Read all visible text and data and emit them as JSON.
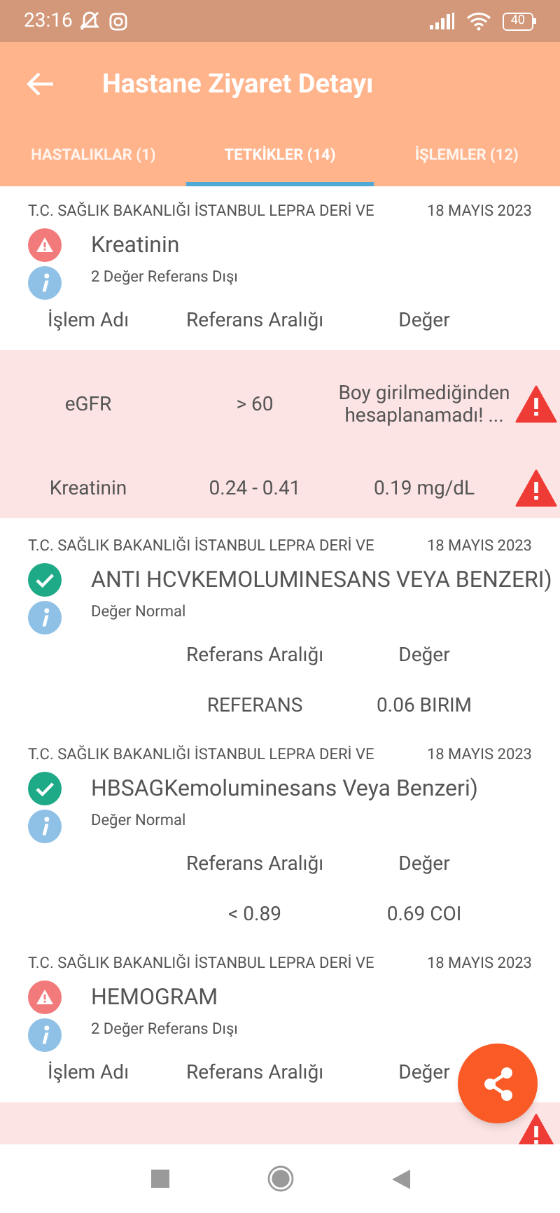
{
  "status_bar": {
    "time": "23:16",
    "battery": "40"
  },
  "app_bar": {
    "title": "Hastane Ziyaret Detayı"
  },
  "tabs": [
    {
      "label": "HASTALIKLAR (1)",
      "selected": false
    },
    {
      "label": "TETKİKLER (14)",
      "selected": true
    },
    {
      "label": "İŞLEMLER (12)",
      "selected": false
    }
  ],
  "results": [
    {
      "institution": "T.C. SAĞLIK BAKANLIĞI İSTANBUL LEPRA DERİ VE",
      "date": "18 MAYIS 2023",
      "kind": "abnormal",
      "title": "Kreatinin",
      "summary": "2 Değer Referans Dışı",
      "columns": [
        "İşlem Adı",
        "Referans Aralığı",
        "Değer"
      ],
      "rows": [
        {
          "name": "eGFR",
          "reference": "> 60",
          "value": "Boy girilmediğinden hesaplanamadı! ...",
          "out_of_range": true
        },
        {
          "name": "Kreatinin",
          "reference": "0.24 - 0.41",
          "value": "0.19 mg/dL",
          "out_of_range": true
        }
      ]
    },
    {
      "institution": "T.C. SAĞLIK BAKANLIĞI İSTANBUL LEPRA DERİ VE",
      "date": "18 MAYIS 2023",
      "kind": "normal",
      "title": "ANTI HCVKEMOLUMINESANS VEYA BENZERI)",
      "summary": "Değer Normal",
      "columns": [
        "",
        "Referans Aralığı",
        "Değer"
      ],
      "rows": [
        {
          "name": "",
          "reference": "REFERANS",
          "value": "0.06 BIRIM",
          "out_of_range": false
        }
      ]
    },
    {
      "institution": "T.C. SAĞLIK BAKANLIĞI İSTANBUL LEPRA DERİ VE",
      "date": "18 MAYIS 2023",
      "kind": "normal",
      "title": "HBSAGKemoluminesans Veya Benzeri)",
      "summary": "Değer Normal",
      "columns": [
        "",
        "Referans Aralığı",
        "Değer"
      ],
      "rows": [
        {
          "name": "",
          "reference": "< 0.89",
          "value": "0.69 COI",
          "out_of_range": false
        }
      ]
    },
    {
      "institution": "T.C. SAĞLIK BAKANLIĞI İSTANBUL LEPRA DERİ VE",
      "date": "18 MAYIS 2023",
      "kind": "abnormal",
      "title": "HEMOGRAM",
      "summary": "2 Değer Referans Dışı",
      "columns": [
        "İşlem Adı",
        "Referans Aralığı",
        "Değer"
      ],
      "rows": [
        {
          "name": "",
          "reference": "",
          "value": "",
          "out_of_range": true
        }
      ]
    }
  ]
}
